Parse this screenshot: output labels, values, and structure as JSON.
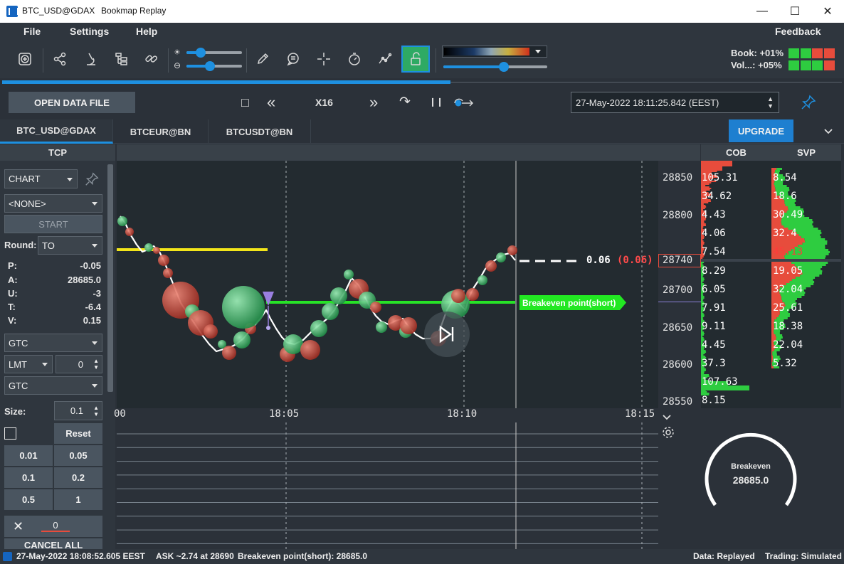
{
  "window": {
    "title": "BTC_USD@GDAX",
    "app_name": "Bookmap Replay",
    "min": "—",
    "max": "☐",
    "close": "✕"
  },
  "menu": {
    "file": "File",
    "settings": "Settings",
    "help": "Help",
    "feedback": "Feedback"
  },
  "toolbar": {
    "icons": [
      "target-icon",
      "share-icon",
      "microscope-icon",
      "hierarchy-icon",
      "link-icon",
      "pencil-icon",
      "chat-icon",
      "crosshair-icon",
      "stopwatch-icon",
      "chart-line-icon",
      "unlock-icon"
    ],
    "brightness_level": 0.25,
    "contrast_level": 0.42,
    "heatmap_level": 0.58,
    "book_label": "Book: +01%",
    "vol_label": "Vol...: +05%",
    "book_bars": [
      "#2ecc40",
      "#2ecc40",
      "#e74c3c",
      "#e74c3c"
    ],
    "vol_bars": [
      "#2ecc40",
      "#2ecc40",
      "#2ecc40",
      "#e74c3c"
    ]
  },
  "progress": {
    "fraction": 0.534,
    "color": "#1e90e0"
  },
  "controls": {
    "open_file": "OPEN DATA FILE",
    "stop": "□",
    "rewind": "«",
    "speed": "X16",
    "forward": "»",
    "jump": "↷",
    "pause": "❙❙",
    "datetime": "27-May-2022 18:11:25.842 (EEST)"
  },
  "tabs": [
    {
      "label": "BTC_USD@GDAX",
      "active": true
    },
    {
      "label": "BTCEUR@BN",
      "active": false
    },
    {
      "label": "BTCUSDT@BN",
      "active": false
    }
  ],
  "upgrade": "UPGRADE",
  "tcp": {
    "title": "TCP",
    "mode": "CHART",
    "account": "<NONE>",
    "start": "START",
    "round_label": "Round:",
    "round_value": "TO",
    "p_label": "P:",
    "p_value": "-0.05",
    "a_label": "A:",
    "a_value": "28685.0",
    "u_label": "U:",
    "u_value": "-3",
    "t_label": "T:",
    "t_value": "-6.4",
    "v_label": "V:",
    "v_value": "0.15",
    "tif1": "GTC",
    "order_type": "LMT",
    "offset": "0",
    "tif2": "GTC",
    "size_label": "Size:",
    "size_value": "0.1",
    "reset": "Reset",
    "qty": [
      "0.01",
      "0.05",
      "0.1",
      "0.2",
      "0.5",
      "1"
    ],
    "cancel_x": "✕",
    "cancel_qty": "0",
    "cancel_all": "CANCEL ALL"
  },
  "chart": {
    "time_labels": [
      "00",
      "18:05",
      "18:10",
      "18:15"
    ],
    "annotation_value": "0.06",
    "annotation_paren": "(0.06)",
    "breakeven_label": "Breakeven point(short)"
  },
  "price_axis": {
    "labels": [
      "28850",
      "28800",
      "28740",
      "28700",
      "28650",
      "28600",
      "28550"
    ],
    "current": "28740"
  },
  "cob": {
    "title": "COB",
    "values": [
      "105.31",
      "34.62",
      "4.43",
      "4.06",
      "7.54",
      "8.29",
      "6.05",
      "7.91",
      "9.11",
      "4.45",
      "37.3",
      "107.63",
      "8.15"
    ]
  },
  "svp": {
    "title": "SVP",
    "values": [
      "8.54",
      "18.6",
      "30.49",
      "32.4",
      "45.13",
      "19.05",
      "32.04",
      "25.61",
      "18.38",
      "22.04",
      "5.32"
    ]
  },
  "gauge": {
    "label": "Breakeven",
    "value": "28685.0"
  },
  "status": {
    "left": "27-May-2022 18:08:52.605 EEST",
    "ask": "ASK ~2.74 at 28690",
    "breakeven": "Breakeven point(short): 28685.0",
    "data": "Data: Replayed",
    "trading": "Trading: Simulated"
  }
}
